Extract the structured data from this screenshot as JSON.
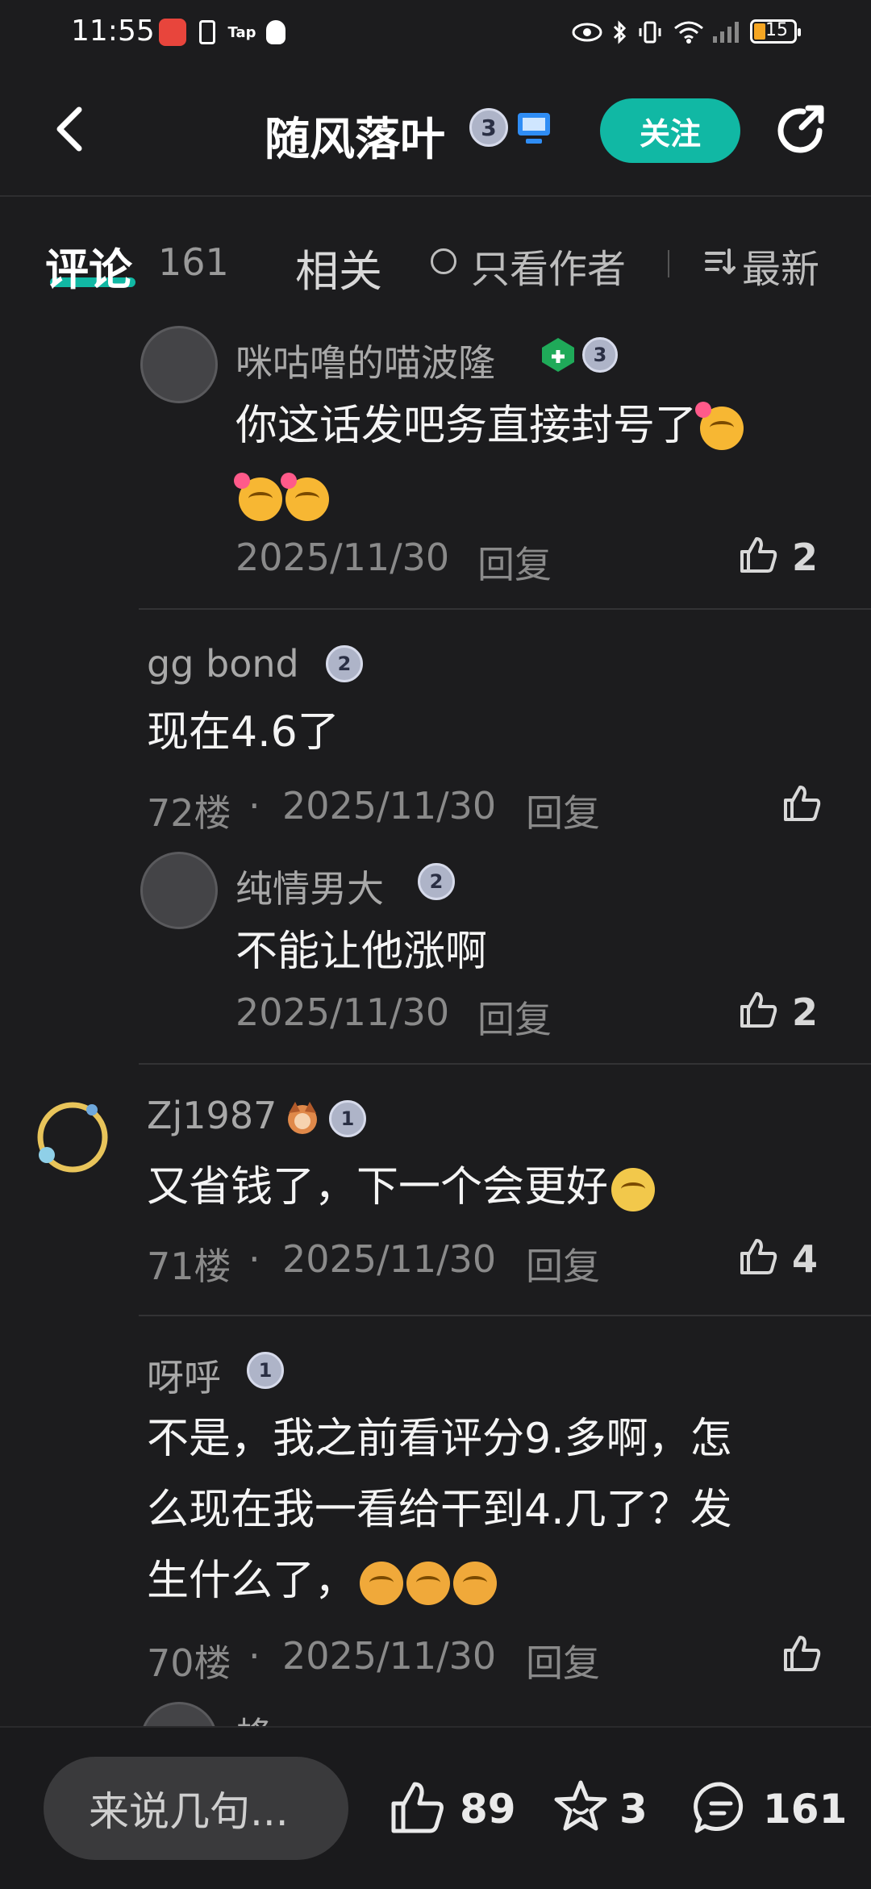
{
  "status_bar": {
    "time": "11:55",
    "battery": "15",
    "icons": [
      "huawei-app-icon",
      "alert-icon",
      "tap-icon",
      "qq-icon",
      "eye-icon",
      "bluetooth-icon",
      "vibrate-icon",
      "wifi-icon",
      "signal-icon"
    ]
  },
  "header": {
    "title": "随风落叶",
    "level_badge": "3",
    "follow_label": "关注"
  },
  "tabs": {
    "comments_label": "评论",
    "comments_count": "161",
    "related_label": "相关",
    "only_author_label": "只看作者",
    "sort_label": "最新"
  },
  "comments": [
    {
      "kind": "reply",
      "name": "咪咕噜的喵波隆",
      "level": "3",
      "text_line1": "你这话发吧务直接封号了",
      "date": "2025/11/30",
      "reply_label": "回复",
      "likes": "2"
    },
    {
      "kind": "top",
      "name": "gg bond",
      "level": "2",
      "text": "现在4.6了",
      "floor": "72楼",
      "date": "2025/11/30",
      "reply_label": "回复"
    },
    {
      "kind": "reply",
      "name": "纯情男大",
      "level": "2",
      "text": "不能让他涨啊",
      "date": "2025/11/30",
      "reply_label": "回复",
      "likes": "2"
    },
    {
      "kind": "top",
      "name": "Zj1987",
      "level": "1",
      "text": "又省钱了，下一个会更好",
      "floor": "71楼",
      "date": "2025/11/30",
      "reply_label": "回复",
      "likes": "4"
    },
    {
      "kind": "top",
      "name": "呀呼",
      "level": "1",
      "text_line1": "不是，我之前看评分9.多啊，怎",
      "text_line2": "么现在我一看给干到4.几了？发",
      "text_line3": "生什么了，",
      "floor": "70楼",
      "date": "2025/11/30",
      "reply_label": "回复"
    },
    {
      "kind": "partial",
      "name": "蜂"
    }
  ],
  "bottom_bar": {
    "input_placeholder": "来说几句...",
    "like_count": "89",
    "star_count": "3",
    "comment_count": "161"
  },
  "colors": {
    "accent": "#11b8a4",
    "background": "#1c1c1e"
  }
}
